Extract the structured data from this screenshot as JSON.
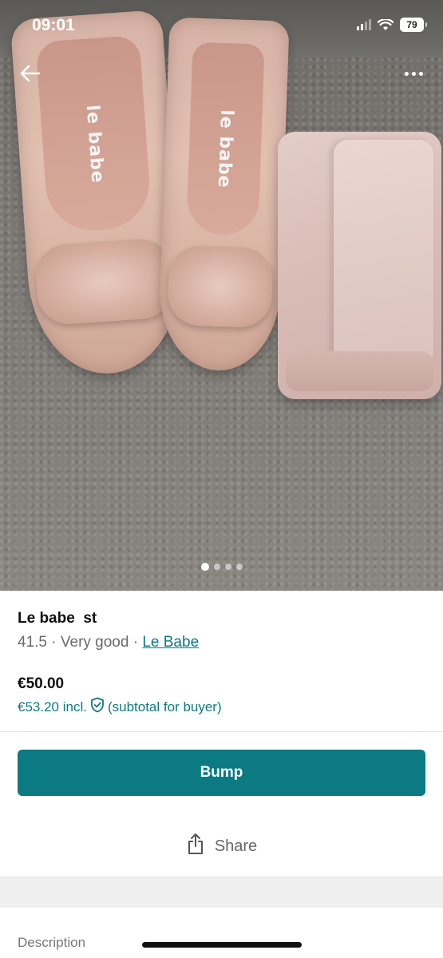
{
  "status_bar": {
    "time": "09:01",
    "battery": "79"
  },
  "photo": {
    "brand_imprint": "le babe",
    "page_count": 4,
    "active_page": 1
  },
  "item": {
    "title": "Le babe  st",
    "size": "41.5",
    "condition": "Very good",
    "separator": "·",
    "brand": "Le Babe",
    "price": "€50.00",
    "price_incl": "€53.20 incl.",
    "price_incl_note": "(subtotal for buyer)"
  },
  "actions": {
    "bump_label": "Bump",
    "share_label": "Share"
  },
  "sections": {
    "description_label": "Description"
  },
  "colors": {
    "accent": "#0b7a82",
    "title_text": "#111111",
    "muted_text": "#6a6a6a",
    "band": "#efefef"
  }
}
